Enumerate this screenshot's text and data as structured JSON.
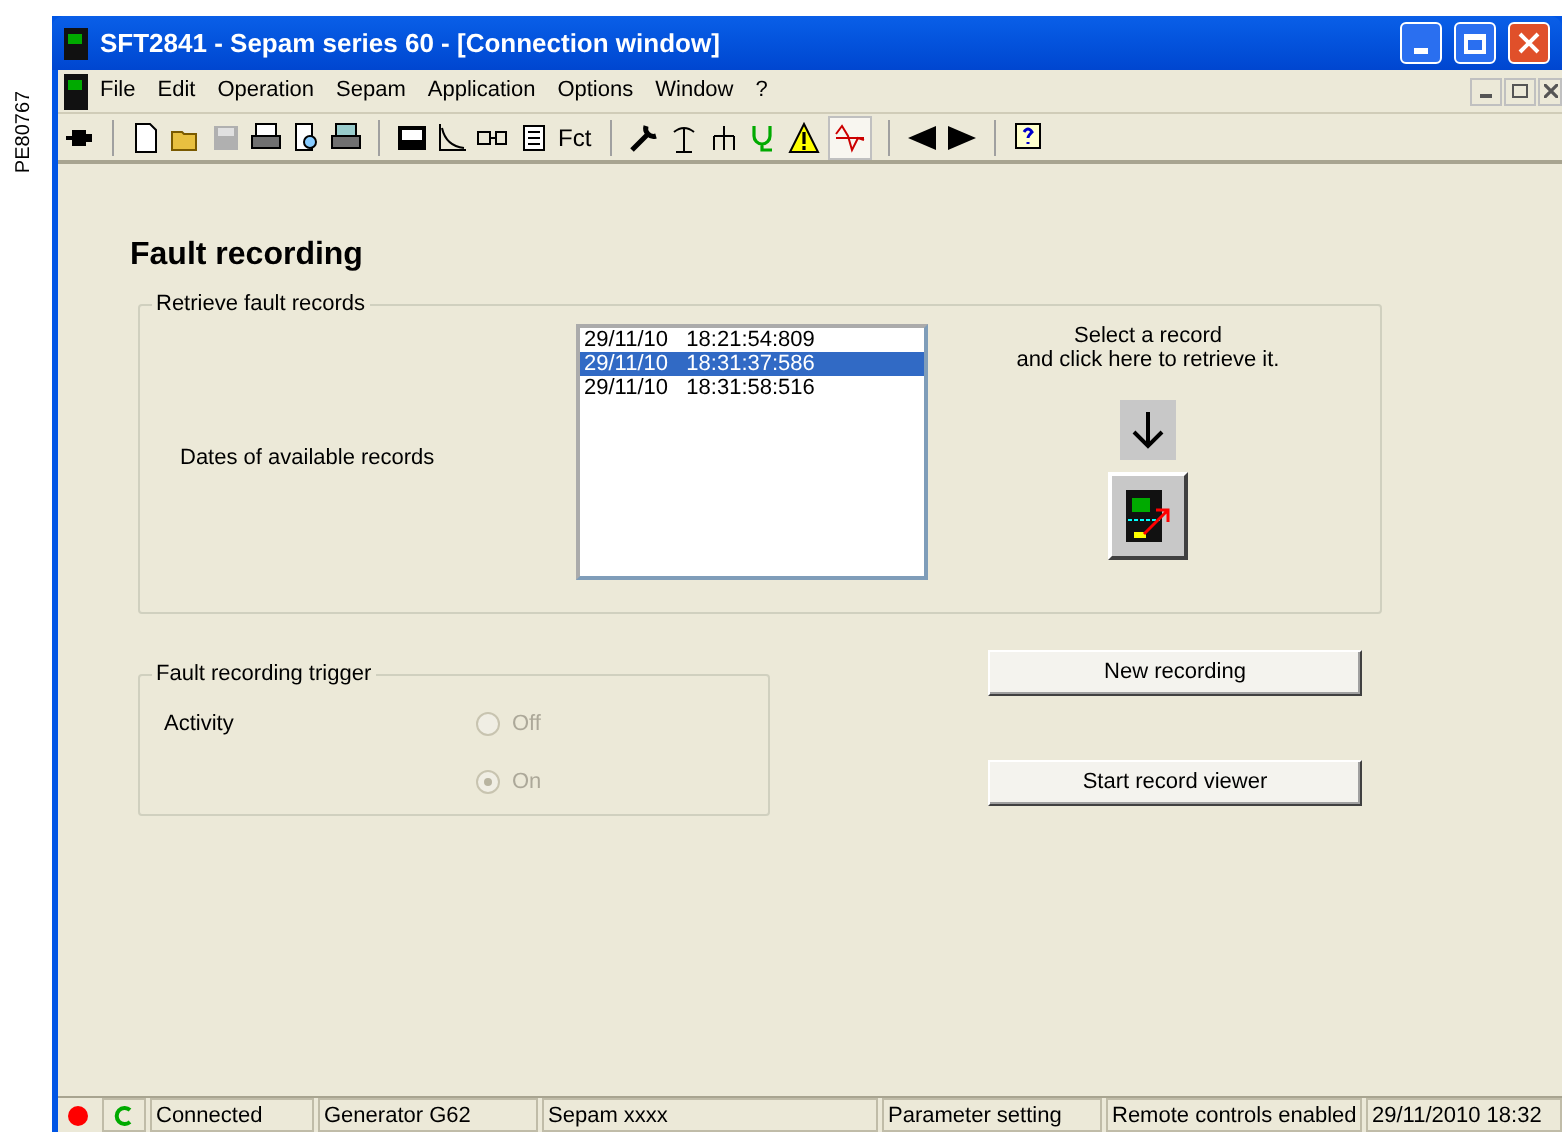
{
  "side_label": "PE80767",
  "window": {
    "title": "SFT2841 - Sepam series 60 - [Connection window]"
  },
  "menu": [
    "File",
    "Edit",
    "Operation",
    "Sepam",
    "Application",
    "Options",
    "Window",
    "?"
  ],
  "toolbar": {
    "text_button": "Fct",
    "waveform_button_selected": true
  },
  "page_title": "Fault recording",
  "retrieve_group": {
    "title": "Retrieve fault records",
    "label": "Dates of available records",
    "records": [
      {
        "text": "29/11/10   18:21:54:809",
        "selected": false
      },
      {
        "text": "29/11/10   18:31:37:586",
        "selected": true
      },
      {
        "text": "29/11/10   18:31:58:516",
        "selected": false
      }
    ],
    "hint_lines": [
      "Select a record",
      "and click here to retrieve it."
    ]
  },
  "trigger_group": {
    "title": "Fault recording trigger",
    "label": "Activity",
    "options": [
      {
        "label": "Off",
        "selected": false,
        "disabled": true
      },
      {
        "label": "On",
        "selected": true,
        "disabled": true
      }
    ]
  },
  "buttons": [
    "New recording",
    "Start record viewer"
  ],
  "status_bar": [
    "Connected",
    "Generator G62",
    "Sepam xxxx",
    "Parameter setting",
    "Remote controls enabled",
    "29/11/2010 18:32"
  ]
}
